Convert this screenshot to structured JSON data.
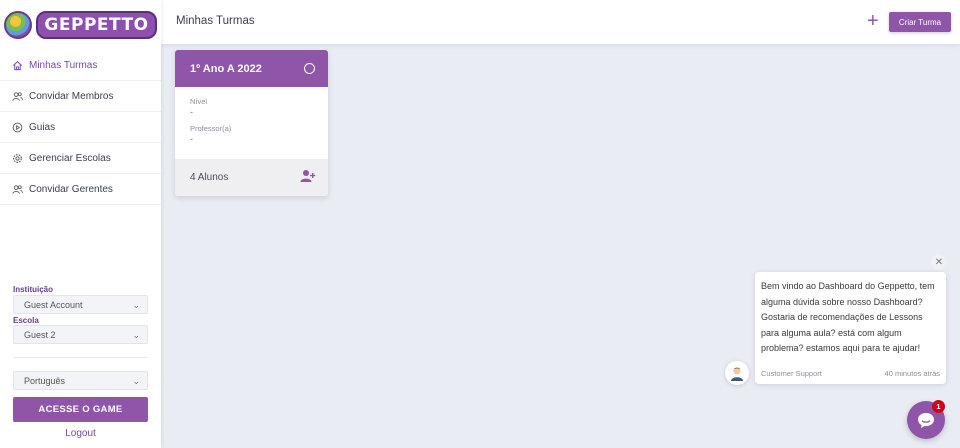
{
  "brand": {
    "logo_text": "GEPPETTO",
    "accent": "#8e55a8"
  },
  "sidebar": {
    "items": [
      {
        "label": "Minhas Turmas",
        "icon": "home-icon",
        "active": true
      },
      {
        "label": "Convidar Membros",
        "icon": "users-icon"
      },
      {
        "label": "Guias",
        "icon": "play-circle-icon"
      },
      {
        "label": "Gerenciar Escolas",
        "icon": "gear-icon"
      },
      {
        "label": "Convidar Gerentes",
        "icon": "users-icon"
      }
    ],
    "institution_label": "Instituição",
    "institution_value": "Guest Account",
    "school_label": "Escola",
    "school_value": "Guest 2",
    "language_value": "Português",
    "game_button": "ACESSE O GAME",
    "logout": "Logout"
  },
  "header": {
    "title": "Minhas Turmas",
    "create_button": "Criar Turma"
  },
  "class_card": {
    "title": "1º Ano A 2022",
    "level_label": "Nível",
    "level_value": "-",
    "teacher_label": "Professor(a)",
    "teacher_value": "-",
    "students": "4 Alunos"
  },
  "chat": {
    "message": "Bem vindo ao Dashboard do Geppetto, tem alguma dúvida sobre nosso Dashboard? Gostaria de recomendações de Lessons para alguma aula? está com algum problema? estamos aqui para te ajudar!",
    "sender": "Customer Support",
    "time": "40 minutos atrás",
    "badge": "1"
  }
}
